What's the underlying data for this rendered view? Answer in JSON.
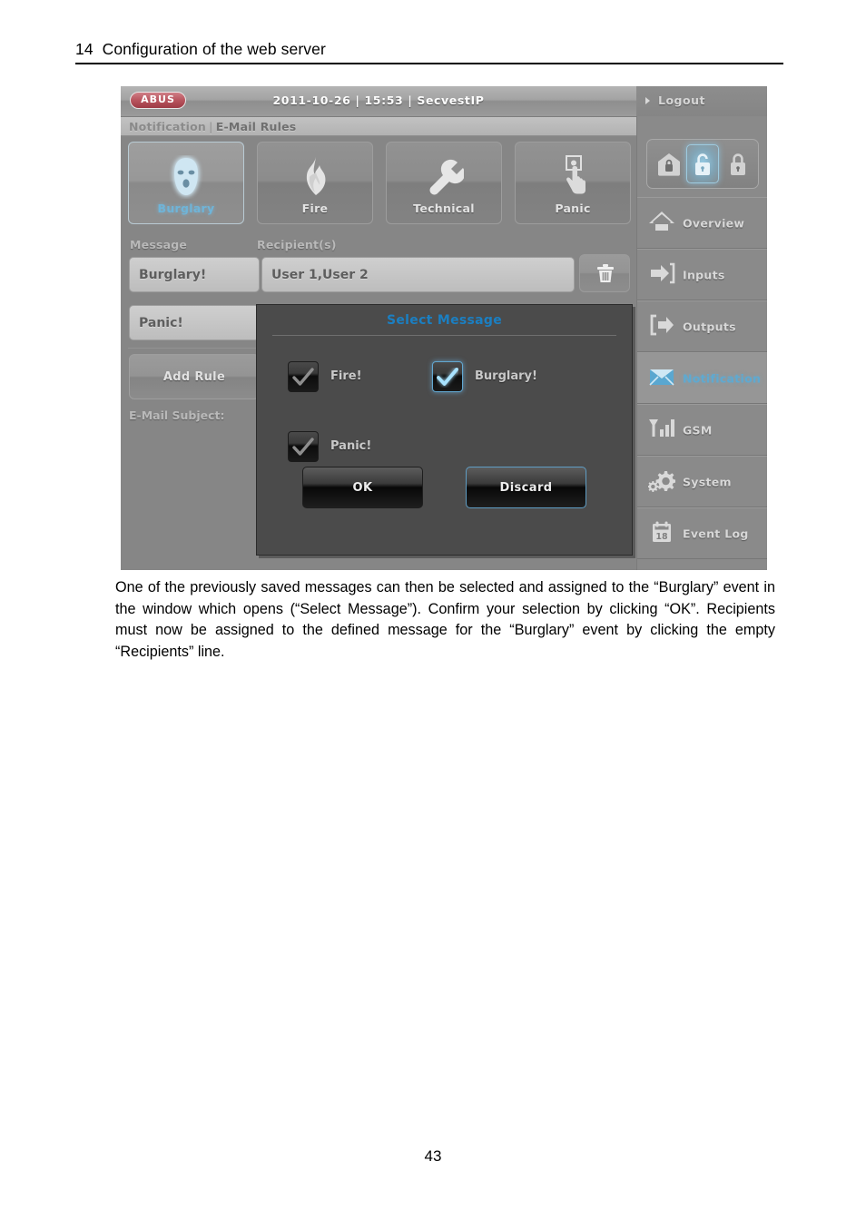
{
  "document": {
    "chapter_heading": "14  Configuration of the web server",
    "page_number": "43",
    "paragraph": "One of the previously saved messages can then be selected and assigned to the “Burglary” event in the window which opens (“Select Message”). Confirm your selection by clicking “OK”. Recipients must now be assigned to the defined message for the “Burglary” event by clicking the empty “Recipients” line."
  },
  "screenshot": {
    "titlebar": {
      "logo": "ABUS",
      "status": "2011-10-26  |  15:53  |  SecvestIP",
      "date": "2011-10-26",
      "time": "15:53",
      "device": "SecvestIP",
      "logout_label": "Logout"
    },
    "breadcrumb": {
      "section": "Notification",
      "separator": "|",
      "page": "E-Mail Rules"
    },
    "tabs": [
      {
        "label": "Burglary",
        "icon": "burglar-mask-icon",
        "selected": true
      },
      {
        "label": "Fire",
        "icon": "flame-icon",
        "selected": false
      },
      {
        "label": "Technical",
        "icon": "wrench-icon",
        "selected": false
      },
      {
        "label": "Panic",
        "icon": "panic-button-hand-icon",
        "selected": false
      }
    ],
    "rules": {
      "message_header": "Message",
      "recipients_header": "Recipient(s)",
      "rows": [
        {
          "message": "Burglary!",
          "recipients": "User 1,User 2"
        },
        {
          "message": "Panic!",
          "recipients": ""
        }
      ],
      "add_rule_label": "Add Rule",
      "email_subject_label": "E-Mail Subject:",
      "delete_icon": "trash-icon"
    },
    "arm_control": {
      "buttons": [
        {
          "name": "home-lock-icon",
          "selected": false
        },
        {
          "name": "unlocked-padlock-icon",
          "selected": true
        },
        {
          "name": "locked-padlock-icon",
          "selected": false
        }
      ]
    },
    "sidebar": [
      {
        "label": "Overview",
        "icon": "home-icon",
        "active": false
      },
      {
        "label": "Inputs",
        "icon": "arrow-in-icon",
        "active": false
      },
      {
        "label": "Outputs",
        "icon": "arrow-out-icon",
        "active": false
      },
      {
        "label": "Notification",
        "icon": "envelope-icon",
        "active": true
      },
      {
        "label": "GSM",
        "icon": "signal-bars-icon",
        "active": false
      },
      {
        "label": "System",
        "icon": "gears-icon",
        "active": false
      },
      {
        "label": "Event Log",
        "icon": "calendar-icon",
        "active": false,
        "icon_text": "18"
      }
    ],
    "dialog": {
      "title": "Select Message",
      "options": [
        {
          "label": "Fire!",
          "checked": false
        },
        {
          "label": "Burglary!",
          "checked": true
        },
        {
          "label": "Panic!",
          "checked": false
        }
      ],
      "ok_label": "OK",
      "discard_label": "Discard"
    },
    "colors": {
      "accent_blue": "#1b7fc2",
      "selected_label_blue": "#6fb4d8",
      "panel_grey": "#868686",
      "dialog_grey": "#4b4b4b"
    }
  }
}
